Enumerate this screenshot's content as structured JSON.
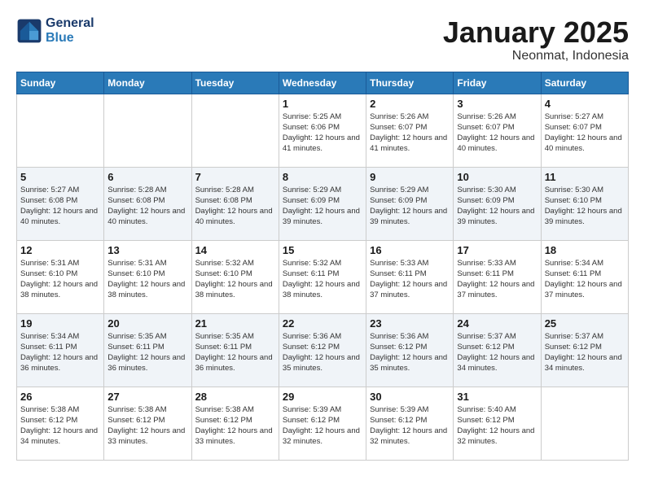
{
  "logo": {
    "line1": "General",
    "line2": "Blue"
  },
  "title": "January 2025",
  "subtitle": "Neonmat, Indonesia",
  "days_of_week": [
    "Sunday",
    "Monday",
    "Tuesday",
    "Wednesday",
    "Thursday",
    "Friday",
    "Saturday"
  ],
  "weeks": [
    [
      {
        "day": "",
        "info": ""
      },
      {
        "day": "",
        "info": ""
      },
      {
        "day": "",
        "info": ""
      },
      {
        "day": "1",
        "info": "Sunrise: 5:25 AM\nSunset: 6:06 PM\nDaylight: 12 hours\nand 41 minutes."
      },
      {
        "day": "2",
        "info": "Sunrise: 5:26 AM\nSunset: 6:07 PM\nDaylight: 12 hours\nand 41 minutes."
      },
      {
        "day": "3",
        "info": "Sunrise: 5:26 AM\nSunset: 6:07 PM\nDaylight: 12 hours\nand 40 minutes."
      },
      {
        "day": "4",
        "info": "Sunrise: 5:27 AM\nSunset: 6:07 PM\nDaylight: 12 hours\nand 40 minutes."
      }
    ],
    [
      {
        "day": "5",
        "info": "Sunrise: 5:27 AM\nSunset: 6:08 PM\nDaylight: 12 hours\nand 40 minutes."
      },
      {
        "day": "6",
        "info": "Sunrise: 5:28 AM\nSunset: 6:08 PM\nDaylight: 12 hours\nand 40 minutes."
      },
      {
        "day": "7",
        "info": "Sunrise: 5:28 AM\nSunset: 6:08 PM\nDaylight: 12 hours\nand 40 minutes."
      },
      {
        "day": "8",
        "info": "Sunrise: 5:29 AM\nSunset: 6:09 PM\nDaylight: 12 hours\nand 39 minutes."
      },
      {
        "day": "9",
        "info": "Sunrise: 5:29 AM\nSunset: 6:09 PM\nDaylight: 12 hours\nand 39 minutes."
      },
      {
        "day": "10",
        "info": "Sunrise: 5:30 AM\nSunset: 6:09 PM\nDaylight: 12 hours\nand 39 minutes."
      },
      {
        "day": "11",
        "info": "Sunrise: 5:30 AM\nSunset: 6:10 PM\nDaylight: 12 hours\nand 39 minutes."
      }
    ],
    [
      {
        "day": "12",
        "info": "Sunrise: 5:31 AM\nSunset: 6:10 PM\nDaylight: 12 hours\nand 38 minutes."
      },
      {
        "day": "13",
        "info": "Sunrise: 5:31 AM\nSunset: 6:10 PM\nDaylight: 12 hours\nand 38 minutes."
      },
      {
        "day": "14",
        "info": "Sunrise: 5:32 AM\nSunset: 6:10 PM\nDaylight: 12 hours\nand 38 minutes."
      },
      {
        "day": "15",
        "info": "Sunrise: 5:32 AM\nSunset: 6:11 PM\nDaylight: 12 hours\nand 38 minutes."
      },
      {
        "day": "16",
        "info": "Sunrise: 5:33 AM\nSunset: 6:11 PM\nDaylight: 12 hours\nand 37 minutes."
      },
      {
        "day": "17",
        "info": "Sunrise: 5:33 AM\nSunset: 6:11 PM\nDaylight: 12 hours\nand 37 minutes."
      },
      {
        "day": "18",
        "info": "Sunrise: 5:34 AM\nSunset: 6:11 PM\nDaylight: 12 hours\nand 37 minutes."
      }
    ],
    [
      {
        "day": "19",
        "info": "Sunrise: 5:34 AM\nSunset: 6:11 PM\nDaylight: 12 hours\nand 36 minutes."
      },
      {
        "day": "20",
        "info": "Sunrise: 5:35 AM\nSunset: 6:11 PM\nDaylight: 12 hours\nand 36 minutes."
      },
      {
        "day": "21",
        "info": "Sunrise: 5:35 AM\nSunset: 6:11 PM\nDaylight: 12 hours\nand 36 minutes."
      },
      {
        "day": "22",
        "info": "Sunrise: 5:36 AM\nSunset: 6:12 PM\nDaylight: 12 hours\nand 35 minutes."
      },
      {
        "day": "23",
        "info": "Sunrise: 5:36 AM\nSunset: 6:12 PM\nDaylight: 12 hours\nand 35 minutes."
      },
      {
        "day": "24",
        "info": "Sunrise: 5:37 AM\nSunset: 6:12 PM\nDaylight: 12 hours\nand 34 minutes."
      },
      {
        "day": "25",
        "info": "Sunrise: 5:37 AM\nSunset: 6:12 PM\nDaylight: 12 hours\nand 34 minutes."
      }
    ],
    [
      {
        "day": "26",
        "info": "Sunrise: 5:38 AM\nSunset: 6:12 PM\nDaylight: 12 hours\nand 34 minutes."
      },
      {
        "day": "27",
        "info": "Sunrise: 5:38 AM\nSunset: 6:12 PM\nDaylight: 12 hours\nand 33 minutes."
      },
      {
        "day": "28",
        "info": "Sunrise: 5:38 AM\nSunset: 6:12 PM\nDaylight: 12 hours\nand 33 minutes."
      },
      {
        "day": "29",
        "info": "Sunrise: 5:39 AM\nSunset: 6:12 PM\nDaylight: 12 hours\nand 32 minutes."
      },
      {
        "day": "30",
        "info": "Sunrise: 5:39 AM\nSunset: 6:12 PM\nDaylight: 12 hours\nand 32 minutes."
      },
      {
        "day": "31",
        "info": "Sunrise: 5:40 AM\nSunset: 6:12 PM\nDaylight: 12 hours\nand 32 minutes."
      },
      {
        "day": "",
        "info": ""
      }
    ]
  ]
}
